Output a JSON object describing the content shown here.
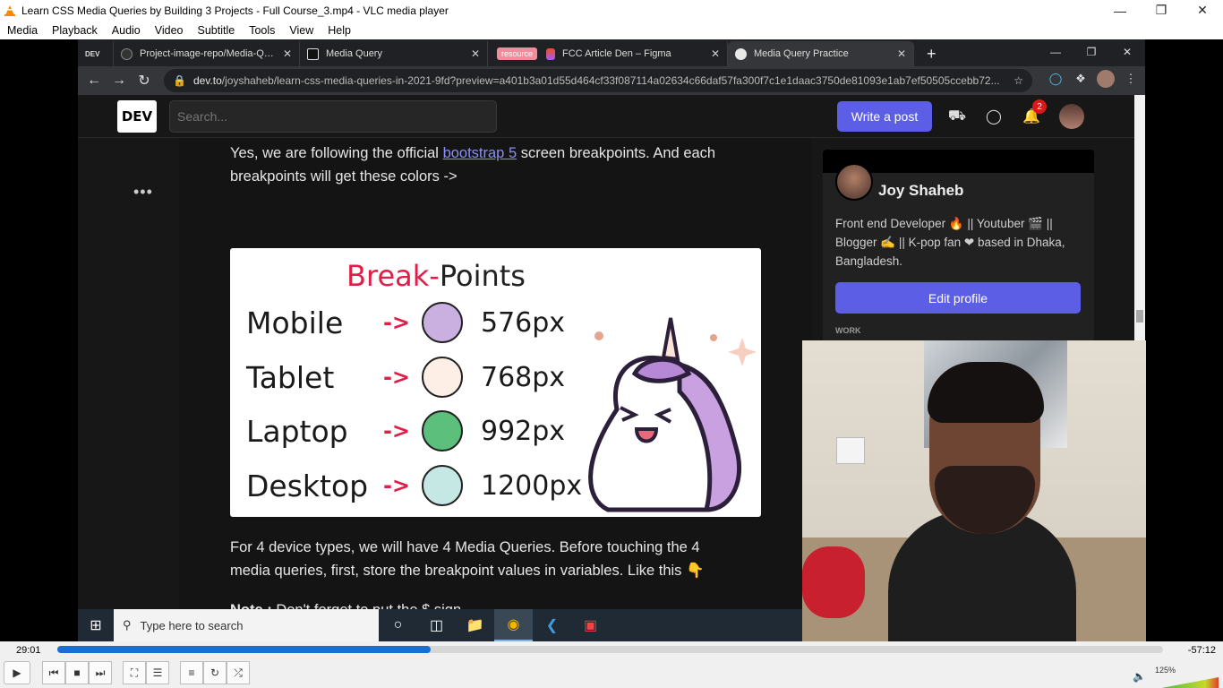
{
  "vlc": {
    "title": "Learn CSS Media Queries by Building 3 Projects - Full Course_3.mp4 - VLC media player",
    "menu": [
      "Media",
      "Playback",
      "Audio",
      "Video",
      "Subtitle",
      "Tools",
      "View",
      "Help"
    ],
    "time_current": "29:01",
    "time_remaining": "-57:12",
    "progress": 0.338,
    "volume_label": "125%",
    "volume": 1.25
  },
  "browser": {
    "tabs": [
      {
        "label": "DEV",
        "kind": "pinned"
      },
      {
        "label": "Project-image-repo/Media-Quer",
        "kind": "github"
      },
      {
        "label": "Media Query",
        "kind": "codepen"
      },
      {
        "label": "FCC Article Den – Figma",
        "kind": "figma",
        "group": "resource"
      },
      {
        "label": "Media Query Practice",
        "kind": "web"
      }
    ],
    "url_host": "dev.to",
    "url_path": "/joyshaheb/learn-css-media-queries-in-2021-9fd?preview=a401b3a01d55d464cf33f087114a02634c66daf57fa300f7c1e1daac3750de81093e1ab7ef50505ccebb72..."
  },
  "dev": {
    "logo": "DEV",
    "search_placeholder": "Search...",
    "write_post": "Write a post",
    "notif_count": "2",
    "article": {
      "para1_before": "Yes, we are following the official ",
      "para1_link": "bootstrap 5",
      "para1_after": " screen breakpoints. And each breakpoints will get these colors ->",
      "para2": "For 4 device types, we will have 4 Media Queries. Before touching the 4 media queries, first, store the breakpoint values in variables. Like this 👇",
      "note_label": "Note :",
      "note_text": " Don't forget to put the $ sign"
    },
    "breakpoints_image": {
      "title_red": "Break-",
      "title_rest": "Points",
      "rows": [
        {
          "name": "Mobile",
          "arrow": "->",
          "px": "576px",
          "color": "#c9b0e0"
        },
        {
          "name": "Tablet",
          "arrow": "->",
          "px": "768px",
          "color": "#fdeee6"
        },
        {
          "name": "Laptop",
          "arrow": "->",
          "px": "992px",
          "color": "#5cbf7c"
        },
        {
          "name": "Desktop",
          "arrow": "->",
          "px": "1200px",
          "color": "#c6e8e4"
        }
      ]
    },
    "profile": {
      "name": "Joy Shaheb",
      "bio": "Front end Developer 🔥 || Youtuber 🎬 || Blogger ✍ || K-pop fan ❤ based in Dhaka, Bangladesh.",
      "edit_button": "Edit profile",
      "work_label": "WORK"
    }
  },
  "taskbar": {
    "search_placeholder": "Type here to search"
  }
}
